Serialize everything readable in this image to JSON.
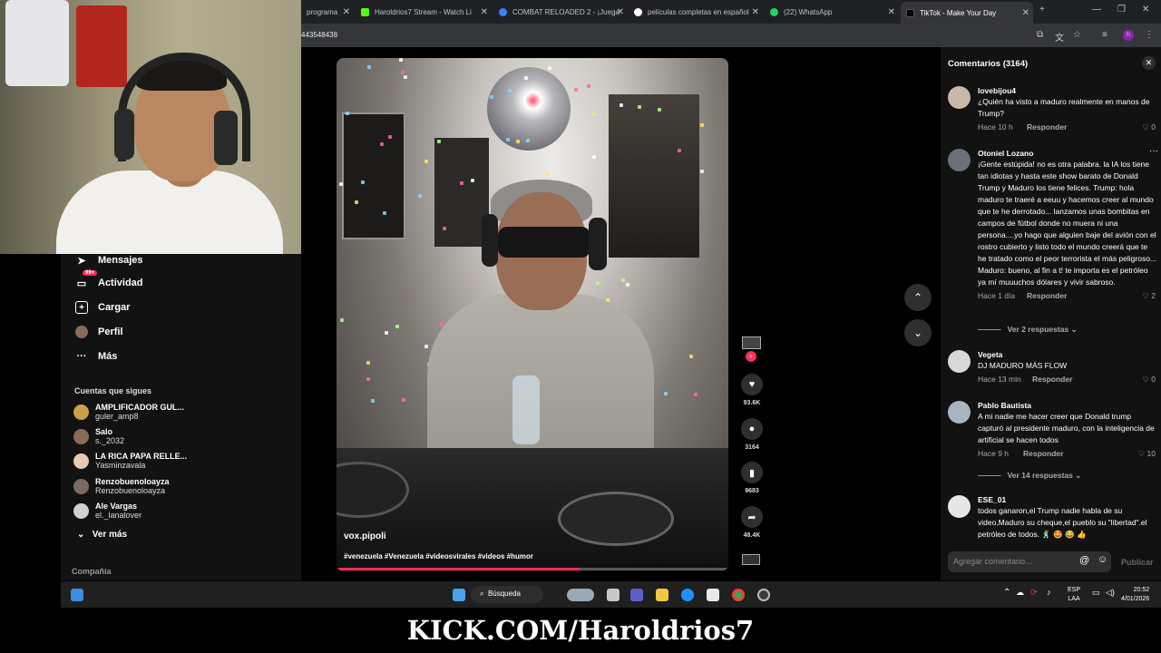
{
  "browser": {
    "tabs": [
      {
        "label": "programa",
        "favicon": "#1f6fd6"
      },
      {
        "label": "Haroldrios7 Stream - Watch Li",
        "favicon": "#53fc18"
      },
      {
        "label": "COMBAT RELOADED 2 - ¡Juega",
        "favicon": "#3b82f6"
      },
      {
        "label": "películas completas en español",
        "favicon": "#fff"
      },
      {
        "label": "(22) WhatsApp",
        "favicon": "#25d366"
      },
      {
        "label": "TikTok - Make Your Day",
        "favicon": "#000"
      }
    ],
    "url": "443548438"
  },
  "sidebar": {
    "nav": [
      {
        "label": "Mensajes",
        "icon": "send-icon"
      },
      {
        "label": "Actividad",
        "icon": "inbox-icon",
        "badge": "99+"
      },
      {
        "label": "Cargar",
        "icon": "upload-icon"
      },
      {
        "label": "Perfil",
        "icon": "profile-icon"
      },
      {
        "label": "Más",
        "icon": "more-icon"
      }
    ],
    "following_title": "Cuentas que sigues",
    "following": [
      {
        "name": "AMPLIFICADOR GUL...",
        "user": "guler_amp8",
        "color": "#c8a14a"
      },
      {
        "name": "Salo",
        "user": "s._2032",
        "color": "#8a6a5a"
      },
      {
        "name": "LA RICA PAPA RELLE...",
        "user": "Yasminzavala",
        "color": "#e8c9b0"
      },
      {
        "name": "Renzobuenoloayza",
        "user": "Renzobuenoloayza",
        "color": "#7a6a60"
      },
      {
        "name": "Ale Vargas",
        "user": "el._lanalover",
        "color": "#d0d0d0"
      }
    ],
    "see_more": "Ver más",
    "company": "Compañía"
  },
  "video": {
    "author": "vox.pipoli",
    "tags": "#venezuela​ #Venezuela #videosvirales #videos #humor",
    "progress": 0.62
  },
  "actions": {
    "likes": "93.6K",
    "comments": "3164",
    "saves": "9683",
    "shares": "48.4K"
  },
  "comments": {
    "title": "Comentarios (3164)",
    "reply_label": "Responder",
    "items": [
      {
        "user": "lovebijou4",
        "text": "¿Quién ha visto a maduro realmente en manos de Trump?",
        "time": "Hace 10 h",
        "likes": "0",
        "avatar": "#c9b7a8"
      },
      {
        "user": "Otoniel Lozano",
        "text": "¡Gente estúpida! no es otra palabra. la IA los tiene tan idiotas y hasta este show barato de Donald Trump y Maduro los tiene felices. Trump: hola maduro te traeré a eeuu y hacemos creer al mundo que te he derrotado... lanzamos unas bombitas en campos de fútbol donde no muera ni una persona....yo hago que alguien baje del avión con el rostro cubierto y listo todo el mundo creerá que te he tratado como el peor terrorista el más peligroso... Maduro: bueno, al fin a t! te importa es el petróleo ya mí muuuchos dólares y vivir sabroso.",
        "time": "Hace 1 día",
        "likes": "2",
        "avatar": "#6b6f7a",
        "replies": "Ver 2 respuestas"
      },
      {
        "user": "Vegeta",
        "text": "DJ MADURO MÁS FLOW",
        "time": "Hace 13 min",
        "likes": "0",
        "avatar": "#d8d8d8"
      },
      {
        "user": "Pablo Bautista",
        "text": "A mi nadie me hacer creer que Donald trump capturó al presidente maduro, con la inteligencia de artificial se hacen todos",
        "time": "Hace 9 h",
        "likes": "10",
        "avatar": "#a7b6c2",
        "replies": "Ver 14 respuestas"
      },
      {
        "user": "ESE_01",
        "text": "todos ganaron,el Trump nadie habla de su video,Maduro su cheque,el pueblo su \"libertad\".el petróleo de todos. 🕺 🤩 😂 👍",
        "time": "",
        "likes": "",
        "avatar": "#e6e6e6"
      }
    ],
    "input_placeholder": "Agregar comentario...",
    "post_label": "Publicar"
  },
  "taskbar": {
    "search": "Búsqueda",
    "lang": "ESP",
    "lang2": "LAA",
    "time": "20:52",
    "date": "4/01/2026"
  },
  "overlay_text": "KICK.COM/Haroldrios7"
}
